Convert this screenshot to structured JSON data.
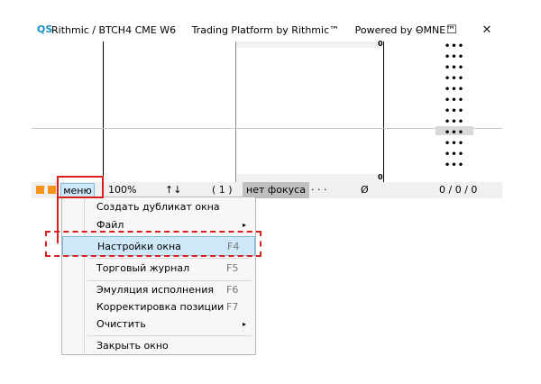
{
  "window": {
    "logo": "QS",
    "title_parts": [
      "Rithmic / BTCH4 CME  W6",
      "Trading Platform by Rithmic™",
      "Powered by OMNE™"
    ],
    "controls": {
      "minimize": "–",
      "maximize": "☐",
      "close": "✕"
    }
  },
  "panel": {
    "zero_top": "0",
    "zero_bottom": "0"
  },
  "dots_rows": [
    "•••",
    "•••",
    "•••",
    "•••",
    "•••",
    "•••",
    "•••",
    "•••",
    "•••",
    "•••",
    "•••",
    "•••"
  ],
  "statusbar": {
    "menu_label": "меню",
    "zoom": "100%",
    "arrows": "↑↓",
    "count": "( 1 )",
    "focus": "нет фокуса",
    "ellipsis": "· · ·",
    "empty": "Ø",
    "counters": "0  /  0  /  0"
  },
  "menu": {
    "items": [
      {
        "label": "Создать дубликат окна",
        "key": ""
      },
      {
        "label": "Файл",
        "key": "",
        "submenu": "▸"
      },
      {
        "label": "Настройки окна",
        "key": "F4"
      },
      {
        "label": "Торговый журнал",
        "key": "F5"
      },
      {
        "label": "Эмуляция исполнения",
        "key": "F6"
      },
      {
        "label": "Корректировка позиции",
        "key": "F7"
      },
      {
        "label": "Очистить",
        "key": "",
        "submenu": "▸"
      },
      {
        "label": "Закрыть окно",
        "key": ""
      }
    ]
  },
  "colors": {
    "highlight": "#d9201f",
    "accent_square": "#f7941d",
    "selected_bg": "#cfe8f8"
  }
}
